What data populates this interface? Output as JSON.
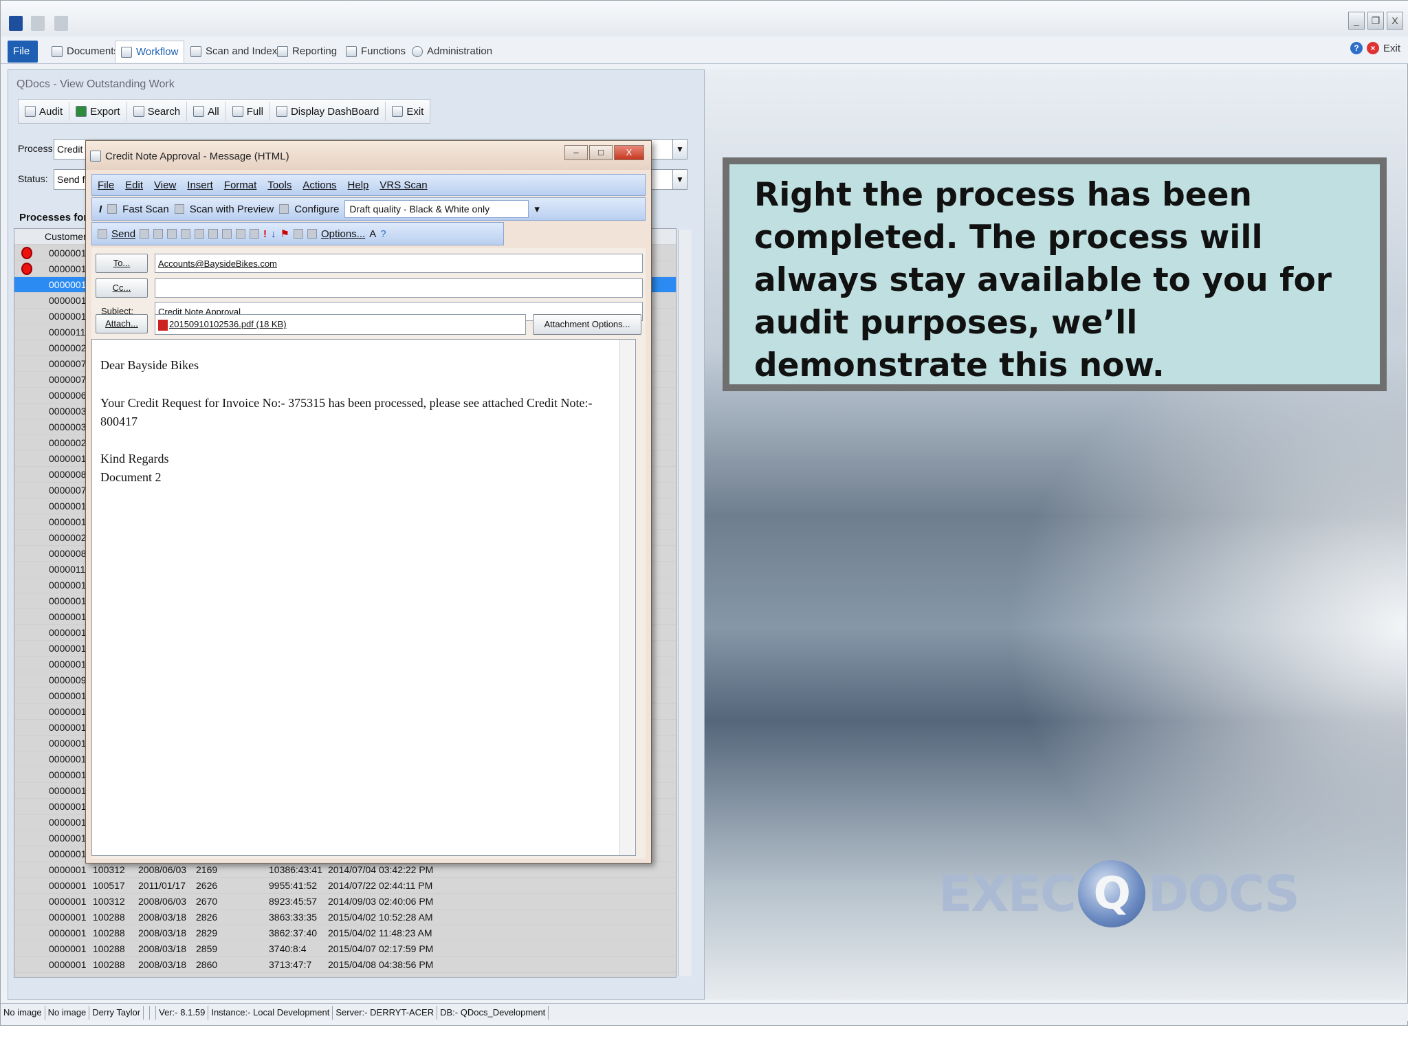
{
  "ribbon": {
    "tabs": [
      "File",
      "Documents",
      "Workflow",
      "Scan and Index",
      "Reporting",
      "Functions",
      "Administration"
    ],
    "active_tab": "Workflow",
    "exit_label": "Exit"
  },
  "left_panel": {
    "title": "QDocs - View Outstanding Work",
    "toolbar": [
      "Audit",
      "Export",
      "Search",
      "All",
      "Full",
      "Display DashBoard",
      "Exit"
    ],
    "process_label": "Process:",
    "process_value": "Credit N",
    "status_label": "Status:",
    "status_value": "Send fo",
    "processes_label": "Processes for y",
    "grid_header": "Customer",
    "rows_hidden_ids": [
      "0000001",
      "0000001",
      "0000001",
      "0000001",
      "0000001",
      "0000011",
      "0000002",
      "0000007",
      "0000007",
      "0000006",
      "0000003",
      "0000003",
      "0000002",
      "0000001",
      "0000008",
      "0000007",
      "0000001",
      "0000001",
      "0000002",
      "0000008",
      "0000011",
      "0000001",
      "0000001",
      "0000001",
      "0000001",
      "0000001",
      "0000001",
      "0000009",
      "0000001",
      "0000001",
      "0000001",
      "0000001",
      "0000001",
      "0000001",
      "0000001",
      "0000001",
      "0000001",
      "0000001",
      "0000001"
    ],
    "rows_full": [
      [
        "0000001",
        "100312",
        "2008/06/03",
        "2169",
        "10386:43:41",
        "2014/07/04 03:42:22 PM"
      ],
      [
        "0000001",
        "100517",
        "2011/01/17",
        "2626",
        "9955:41:52",
        "2014/07/22 02:44:11 PM"
      ],
      [
        "0000001",
        "100312",
        "2008/06/03",
        "2670",
        "8923:45:57",
        "2014/09/03 02:40:06 PM"
      ],
      [
        "0000001",
        "100288",
        "2008/03/18",
        "2826",
        "3863:33:35",
        "2015/04/02 10:52:28 AM"
      ],
      [
        "0000001",
        "100288",
        "2008/03/18",
        "2829",
        "3862:37:40",
        "2015/04/02 11:48:23 AM"
      ],
      [
        "0000001",
        "100288",
        "2008/03/18",
        "2859",
        "3740:8:4",
        "2015/04/07 02:17:59 PM"
      ],
      [
        "0000001",
        "100288",
        "2008/03/18",
        "2860",
        "3713:47:7",
        "2015/04/08 04:38:56 PM"
      ]
    ]
  },
  "dialog": {
    "title": "Credit Note Approval - Message (HTML)",
    "menu": [
      "File",
      "Edit",
      "View",
      "Insert",
      "Format",
      "Tools",
      "Actions",
      "Help",
      "VRS Scan"
    ],
    "scan_toolbar": [
      "Fast Scan",
      "Scan with Preview",
      "Configure"
    ],
    "quality_value": "Draft quality - Black & White only",
    "send_label": "Send",
    "options_label": "Options...",
    "to_label": "To...",
    "to_value": "Accounts@BaysideBikes.com",
    "cc_label": "Cc...",
    "cc_value": "",
    "subject_label": "Subject:",
    "subject_value": "Credit Note Approval",
    "attach_label": "Attach...",
    "attach_value": "20150910102536.pdf (18 KB)",
    "attachment_options_label": "Attachment Options...",
    "body_lines": [
      "Dear Bayside Bikes",
      "Your Credit Request for Invoice No:- 375315 has been processed, please see attached Credit Note:- 800417",
      "Kind Regards",
      "Document 2"
    ]
  },
  "callout": {
    "text": "Right the process has been completed. The process will always stay available to you for audit purposes, we’ll demonstrate this now."
  },
  "logo": {
    "left": "EXEC",
    "q": "Q",
    "right": "DOCS"
  },
  "statusbar": [
    "No image",
    "No image",
    "Derry Taylor",
    "",
    "",
    "Ver:- 8.1.59",
    "Instance:- Local Development",
    "Server:- DERRYT-ACER",
    "DB:- QDocs_Development"
  ],
  "colors": {
    "accent": "#1e5fb3",
    "selected_row": "#2b8bf2",
    "callout_bg": "#bfdfe0",
    "callout_border": "#6f6f6f"
  }
}
